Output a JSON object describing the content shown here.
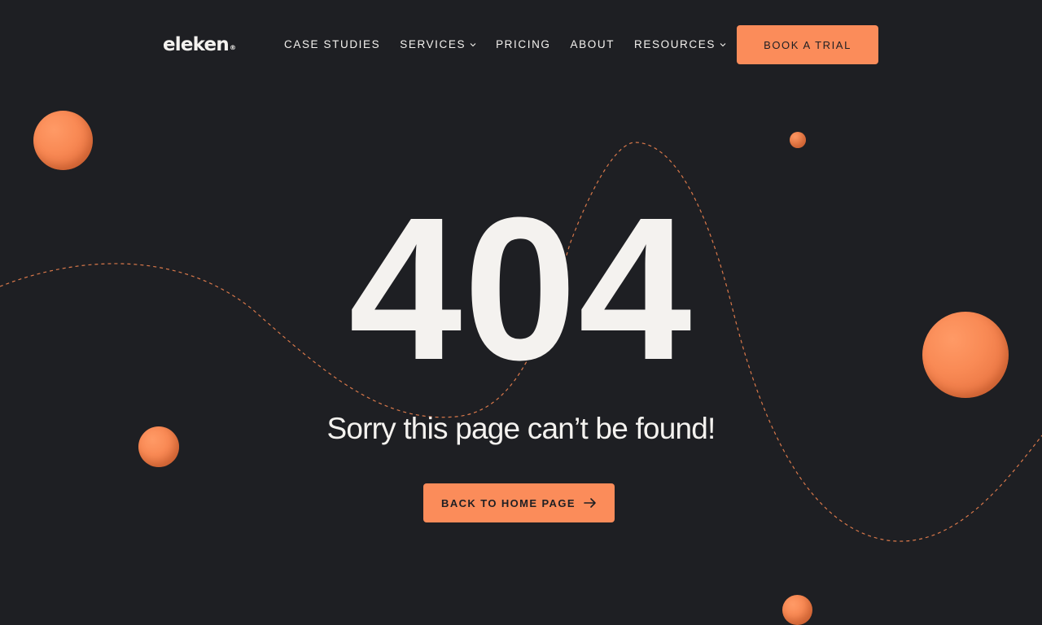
{
  "brand": {
    "logo_text": "eleken",
    "registered_mark": "®",
    "accent_color": "#fb8c5a",
    "background_color": "#1e1f23"
  },
  "nav": {
    "items": [
      {
        "label": "CASE STUDIES",
        "has_dropdown": false
      },
      {
        "label": "SERVICES",
        "has_dropdown": true
      },
      {
        "label": "PRICING",
        "has_dropdown": false
      },
      {
        "label": "ABOUT",
        "has_dropdown": false
      },
      {
        "label": "RESOURCES",
        "has_dropdown": true
      }
    ],
    "cta_label": "BOOK A TRIAL"
  },
  "error": {
    "code": "404",
    "message": "Sorry this page can’t be found!",
    "home_button_label": "BACK TO HOME PAGE",
    "home_button_icon": "arrow-right-icon"
  }
}
